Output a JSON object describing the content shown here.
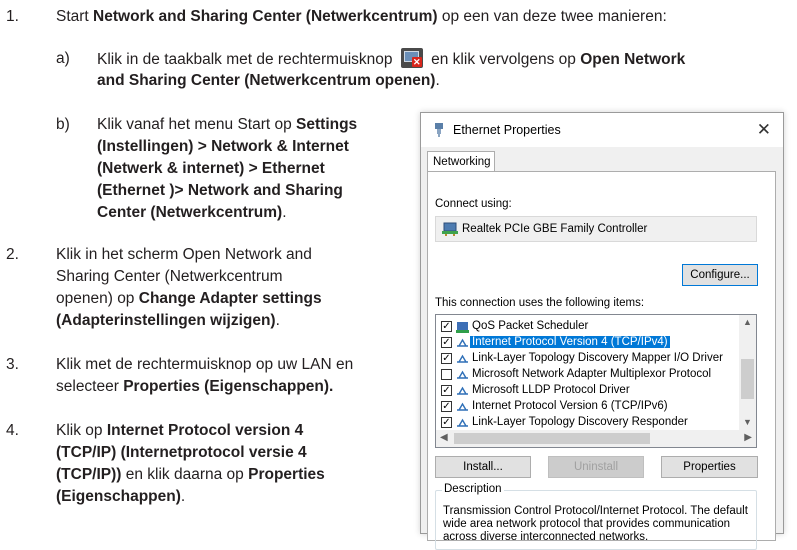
{
  "steps": {
    "s1": {
      "num": "1.",
      "text": "Start ",
      "bold": "Network and Sharing Center (Netwerkcentrum)",
      "tail": " op een van deze twee manieren:"
    },
    "s1a": {
      "num": "a)",
      "pre": "Klik in de taakbalk met de rechtermuisknop",
      "mid": " en klik vervolgens op ",
      "bold1": "Open Network",
      "bold2": "and Sharing Center (Netwerkcentrum openen)",
      "tail": "."
    },
    "s1b": {
      "num": "b)",
      "pre": "Klik vanaf het menu Start op ",
      "bold1": "Settings",
      "bold2": "(Instellingen) > Network & Internet",
      "bold3": "(Netwerk & internet) > Ethernet",
      "bold4": "(Ethernet )> Network and Sharing",
      "bold5": "Center (Netwerkcentrum)",
      "tail": "."
    },
    "s2": {
      "num": "2.",
      "l1": "Klik in het scherm Open Network and",
      "l2": "Sharing Center (Netwerkcentrum",
      "l3": "openen) op ",
      "bold1": "Change Adapter settings",
      "bold2": "(Adapterinstellingen wijzigen)",
      "tail": "."
    },
    "s3": {
      "num": "3.",
      "l1": "Klik met de rechtermuisknop op uw LAN en",
      "l2": "selecteer ",
      "bold": "Properties (Eigenschappen)."
    },
    "s4": {
      "num": "4.",
      "l1": "Klik op ",
      "bold1": "Internet Protocol version 4",
      "bold2": "(TCP/IP) (Internetprotocol versie 4",
      "bold3": "(TCP/IP))",
      "mid": " en klik daarna op ",
      "bold4": "Properties",
      "bold5": "(Eigenschappen)",
      "tail": "."
    }
  },
  "dialog": {
    "title": "Ethernet Properties",
    "close_glyph": "✕",
    "tab": "Networking",
    "connect_using": "Connect using:",
    "adapter": "Realtek PCIe GBE Family Controller",
    "configure": "Configure...",
    "items_label": "This connection uses the following items:",
    "items": [
      {
        "label": "QoS Packet Scheduler",
        "checked": true,
        "icon": "qos-icon"
      },
      {
        "label": "Internet Protocol Version 4 (TCP/IPv4)",
        "checked": true,
        "icon": "protocol-icon",
        "selected": true
      },
      {
        "label": "Link-Layer Topology Discovery Mapper I/O Driver",
        "checked": true,
        "icon": "protocol-icon"
      },
      {
        "label": "Microsoft Network Adapter Multiplexor Protocol",
        "checked": false,
        "icon": "protocol-icon"
      },
      {
        "label": "Microsoft LLDP Protocol Driver",
        "checked": true,
        "icon": "protocol-icon"
      },
      {
        "label": "Internet Protocol Version 6 (TCP/IPv6)",
        "checked": true,
        "icon": "protocol-icon"
      },
      {
        "label": "Link-Layer Topology Discovery Responder",
        "checked": true,
        "icon": "protocol-icon"
      }
    ],
    "install": "Install...",
    "uninstall": "Uninstall",
    "properties": "Properties",
    "description_legend": "Description",
    "description": "Transmission Control Protocol/Internet Protocol. The default wide area network protocol that provides communication across diverse interconnected networks."
  }
}
